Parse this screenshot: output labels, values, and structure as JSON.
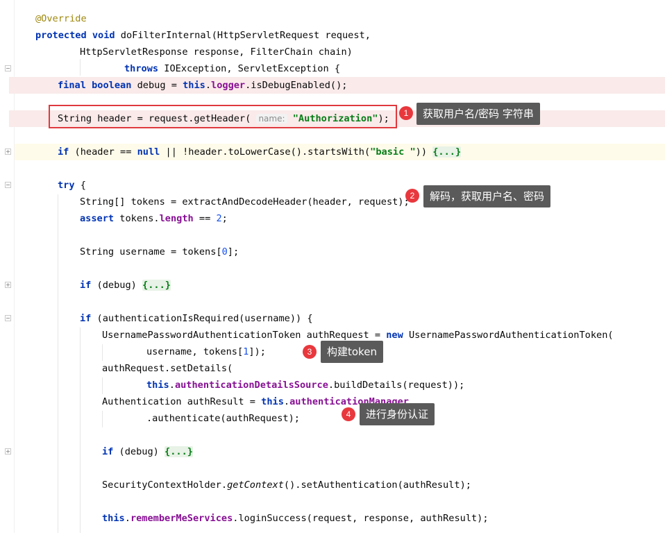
{
  "annotations": [
    {
      "number": "1",
      "text": "获取用户名/密码 字符串"
    },
    {
      "number": "2",
      "text": "解码，获取用户名、密码"
    },
    {
      "number": "3",
      "text": "构建token"
    },
    {
      "number": "4",
      "text": "进行身份认证"
    }
  ],
  "code": {
    "l1": "@Override",
    "l2_kw1": "protected",
    "l2_kw2": "void",
    "l2_rest": " doFilterInternal(HttpServletRequest request,",
    "l3": "HttpServletResponse response, FilterChain chain)",
    "l4_kw": "throws",
    "l4_rest": " IOException, ServletException {",
    "l5_kw1": "final",
    "l5_kw2": "boolean",
    "l5_mid": " debug = ",
    "l5_this": "this",
    "l5_dot": ".",
    "l5_fld": "logger",
    "l5_rest": ".isDebugEnabled();",
    "l6_a": "String header = request.getHeader( ",
    "l6_hint": "name:",
    "l6_str": "\"Authorization\"",
    "l6_end": ");",
    "l7_kw": "if",
    "l7_a": " (header == ",
    "l7_null": "null",
    "l7_b": " || !header.toLowerCase().startsWith(",
    "l7_str": "\"basic \"",
    "l7_c": ")) ",
    "l7_fold": "{...}",
    "l8_kw": "try",
    "l8_rest": " {",
    "l9": "String[] tokens = extractAndDecodeHeader(header, request);",
    "l10_kw": "assert",
    "l10_a": " tokens.",
    "l10_fld": "length",
    "l10_b": " == ",
    "l10_num": "2",
    "l10_c": ";",
    "l11_a": "String username = tokens[",
    "l11_num": "0",
    "l11_b": "];",
    "l12_kw": "if",
    "l12_a": " (debug) ",
    "l12_fold": "{...}",
    "l13_kw": "if",
    "l13_rest": " (authenticationIsRequired(username)) {",
    "l14_a": "UsernamePasswordAuthenticationToken authRequest = ",
    "l14_kw": "new",
    "l14_b": " UsernamePasswordAuthenticationToken(",
    "l15_a": "username, tokens[",
    "l15_num": "1",
    "l15_b": "]);",
    "l16": "authRequest.setDetails(",
    "l17_this": "this",
    "l17_dot": ".",
    "l17_fld": "authenticationDetailsSource",
    "l17_rest": ".buildDetails(request));",
    "l18_a": "Authentication authResult = ",
    "l18_this": "this",
    "l18_dot": ".",
    "l18_fld": "authenticationManager",
    "l19": ".authenticate(authRequest);",
    "l20_kw": "if",
    "l20_a": " (debug) ",
    "l20_fold": "{...}",
    "l21_a": "SecurityContextHolder.",
    "l21_it": "getContext",
    "l21_b": "().setAuthentication(authResult);",
    "l22_this": "this",
    "l22_dot": ".",
    "l22_fld": "rememberMeServices",
    "l22_rest": ".loginSuccess(request, response, authResult);"
  }
}
